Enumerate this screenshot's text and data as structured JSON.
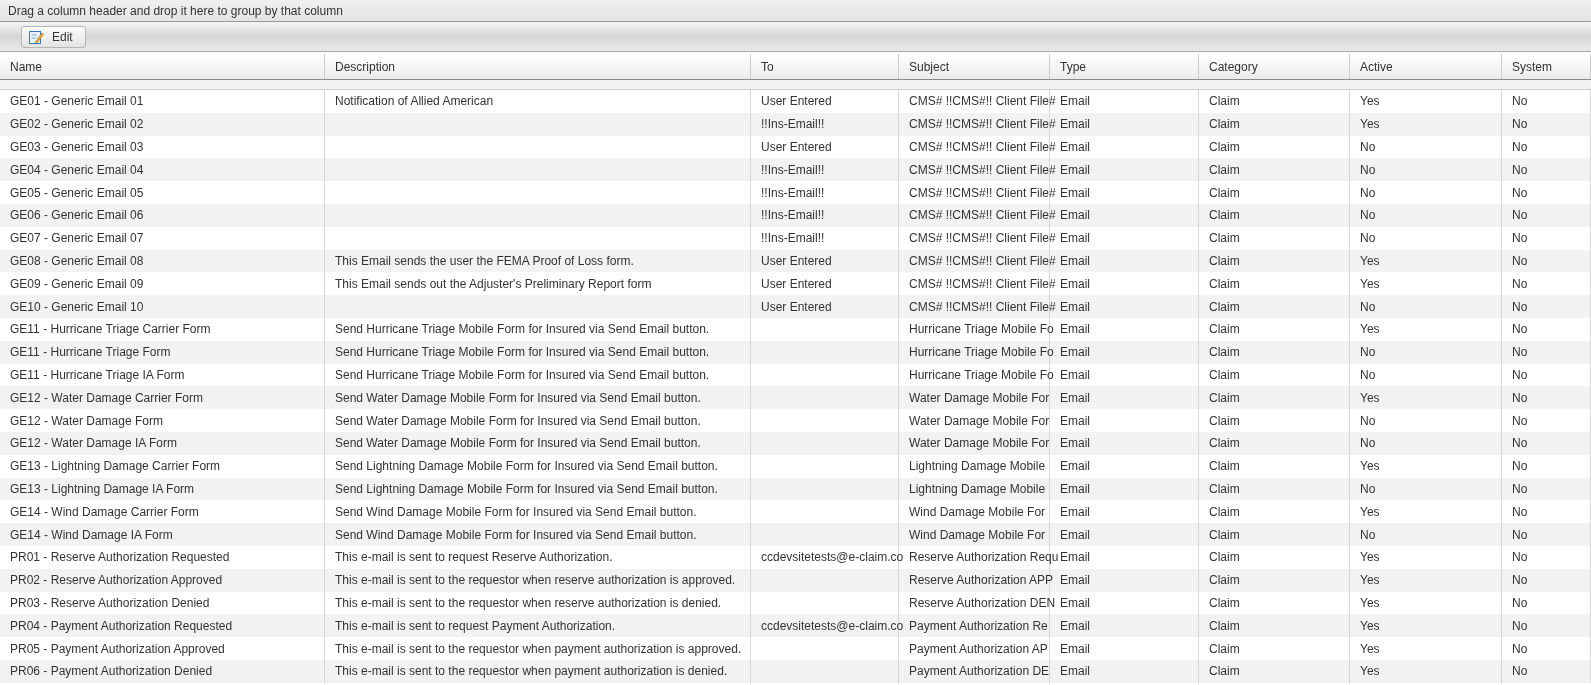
{
  "group_panel": {
    "hint": "Drag a column header and drop it here to group by that column"
  },
  "toolbar": {
    "buttons": [
      {
        "label": "Edit"
      }
    ]
  },
  "table": {
    "columns": [
      "Name",
      "Description",
      "To",
      "Subject",
      "Type",
      "Category",
      "Active",
      "System"
    ],
    "rows": [
      [
        "GE01 - Generic Email 01",
        "Notification of Allied American",
        "User Entered",
        "CMS# !!CMS#!! Client File#",
        "Email",
        "Claim",
        "Yes",
        "No"
      ],
      [
        "GE02 - Generic Email 02",
        "",
        "!!Ins-Email!!",
        "CMS# !!CMS#!! Client File#",
        "Email",
        "Claim",
        "Yes",
        "No"
      ],
      [
        "GE03 - Generic Email 03",
        "",
        "User Entered",
        "CMS# !!CMS#!! Client File#",
        "Email",
        "Claim",
        "No",
        "No"
      ],
      [
        "GE04 - Generic Email 04",
        "",
        "!!Ins-Email!!",
        "CMS# !!CMS#!! Client File#",
        "Email",
        "Claim",
        "No",
        "No"
      ],
      [
        "GE05 - Generic Email 05",
        "",
        "!!Ins-Email!!",
        "CMS# !!CMS#!! Client File#",
        "Email",
        "Claim",
        "No",
        "No"
      ],
      [
        "GE06 - Generic Email 06",
        "",
        "!!Ins-Email!!",
        "CMS# !!CMS#!! Client File#",
        "Email",
        "Claim",
        "No",
        "No"
      ],
      [
        "GE07 - Generic Email 07",
        "",
        "!!Ins-Email!!",
        "CMS# !!CMS#!! Client File#",
        "Email",
        "Claim",
        "No",
        "No"
      ],
      [
        "GE08 - Generic Email 08",
        "This Email sends the user the FEMA Proof of Loss form.",
        "User Entered",
        "CMS# !!CMS#!! Client File#",
        "Email",
        "Claim",
        "Yes",
        "No"
      ],
      [
        "GE09 - Generic Email 09",
        "This Email sends out the Adjuster's Preliminary Report form",
        "User Entered",
        "CMS# !!CMS#!! Client File#",
        "Email",
        "Claim",
        "Yes",
        "No"
      ],
      [
        "GE10 - Generic Email 10",
        "",
        "User Entered",
        "CMS# !!CMS#!! Client File#",
        "Email",
        "Claim",
        "No",
        "No"
      ],
      [
        "GE11 - Hurricane Triage Carrier Form",
        "Send Hurricane Triage Mobile Form for Insured via Send Email button.",
        "",
        "Hurricane Triage Mobile Fo",
        "Email",
        "Claim",
        "Yes",
        "No"
      ],
      [
        "GE11 - Hurricane Triage Form",
        "Send Hurricane Triage Mobile Form for Insured via Send Email button.",
        "",
        "Hurricane Triage Mobile Fo",
        "Email",
        "Claim",
        "No",
        "No"
      ],
      [
        "GE11 - Hurricane Triage IA Form",
        "Send Hurricane Triage Mobile Form for Insured via Send Email button.",
        "",
        "Hurricane Triage Mobile Fo",
        "Email",
        "Claim",
        "No",
        "No"
      ],
      [
        "GE12 - Water Damage Carrier Form",
        "Send Water Damage Mobile Form for Insured via Send Email button.",
        "",
        "Water Damage Mobile For",
        "Email",
        "Claim",
        "Yes",
        "No"
      ],
      [
        "GE12 - Water Damage Form",
        "Send Water Damage Mobile Form for Insured via Send Email button.",
        "",
        "Water Damage Mobile For",
        "Email",
        "Claim",
        "No",
        "No"
      ],
      [
        "GE12 - Water Damage IA Form",
        "Send Water Damage Mobile Form for Insured via Send Email button.",
        "",
        "Water Damage Mobile For",
        "Email",
        "Claim",
        "No",
        "No"
      ],
      [
        "GE13 - Lightning Damage Carrier Form",
        "Send Lightning Damage Mobile Form for Insured via Send Email button.",
        "",
        "Lightning Damage Mobile",
        "Email",
        "Claim",
        "Yes",
        "No"
      ],
      [
        "GE13 - Lightning Damage IA Form",
        "Send Lightning Damage Mobile Form for Insured via Send Email button.",
        "",
        "Lightning Damage Mobile",
        "Email",
        "Claim",
        "No",
        "No"
      ],
      [
        "GE14 - Wind Damage Carrier Form",
        "Send Wind Damage Mobile Form for Insured via Send Email button.",
        "",
        "Wind Damage Mobile For",
        "Email",
        "Claim",
        "Yes",
        "No"
      ],
      [
        "GE14 - Wind Damage IA Form",
        "Send Wind Damage Mobile Form for Insured via Send Email button.",
        "",
        "Wind Damage Mobile For",
        "Email",
        "Claim",
        "No",
        "No"
      ],
      [
        "PR01 - Reserve Authorization Requested",
        "This e-mail is sent to request Reserve Authorization.",
        "ccdevsitetests@e-claim.co",
        "Reserve Authorization Requ",
        "Email",
        "Claim",
        "Yes",
        "No"
      ],
      [
        "PR02 - Reserve Authorization Approved",
        "This e-mail is sent to the requestor when reserve authorization is approved.",
        "",
        "Reserve Authorization APP",
        "Email",
        "Claim",
        "Yes",
        "No"
      ],
      [
        "PR03 - Reserve Authorization Denied",
        "This e-mail is sent to the requestor when reserve authorization is denied.",
        "",
        "Reserve Authorization DEN",
        "Email",
        "Claim",
        "Yes",
        "No"
      ],
      [
        "PR04 - Payment Authorization Requested",
        "This e-mail is sent to request Payment Authorization.",
        "ccdevsitetests@e-claim.co",
        "Payment Authorization Re",
        "Email",
        "Claim",
        "Yes",
        "No"
      ],
      [
        "PR05 - Payment Authorization Approved",
        "This e-mail is sent to the requestor when payment authorization is approved.",
        "",
        "Payment Authorization AP",
        "Email",
        "Claim",
        "Yes",
        "No"
      ],
      [
        "PR06 - Payment Authorization Denied",
        "This e-mail is sent to the requestor when payment authorization is denied.",
        "",
        "Payment Authorization DE",
        "Email",
        "Claim",
        "Yes",
        "No"
      ]
    ]
  }
}
